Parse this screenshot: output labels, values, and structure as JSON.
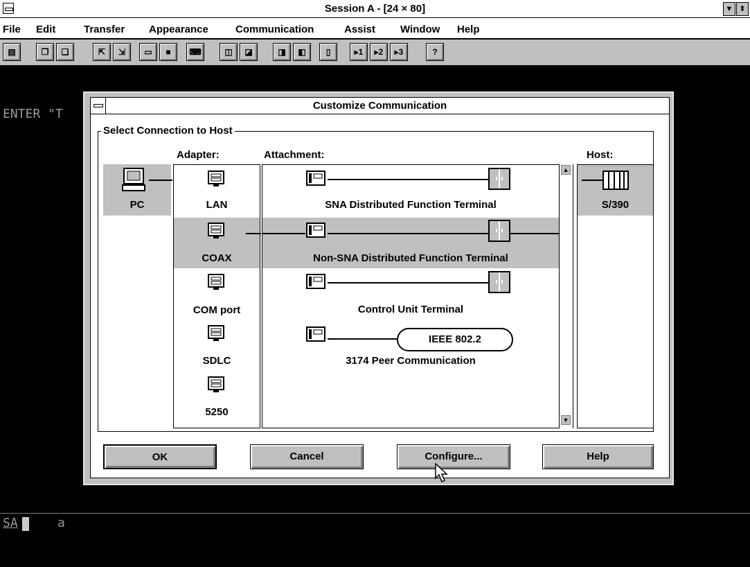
{
  "window": {
    "title": "Session A - [24 × 80]",
    "min_glyph": "▼",
    "max_glyph": "⬍"
  },
  "menu": [
    "File",
    "Edit",
    "Transfer",
    "Appearance",
    "Communication",
    "Assist",
    "Window",
    "Help"
  ],
  "toolbar": {
    "icons": [
      "print-icon",
      "copy-icon",
      "paste-icon",
      "send-file-icon",
      "receive-file-icon",
      "display-icon",
      "display-setup-icon",
      "keyboard-icon",
      "macro-icon",
      "macro-play-icon",
      "connect-icon",
      "disconnect-icon",
      "clipboard-icon",
      "session-1-icon",
      "session-2-icon",
      "session-3-icon",
      "help-icon"
    ],
    "session_labels": [
      "1",
      "2",
      "3"
    ],
    "help_glyph": "?"
  },
  "terminal": {
    "prompt_text": "ENTER \"T",
    "status_left": "SA",
    "status_char": "a"
  },
  "dialog": {
    "title": "Customize Communication",
    "group_label": "Select Connection to Host",
    "adapter_header": "Adapter:",
    "attachment_header": "Attachment:",
    "host_header": "Host:",
    "pc_label": "PC",
    "adapters": [
      "LAN",
      "COAX",
      "COM port",
      "SDLC",
      "5250"
    ],
    "selected_adapter": "COAX",
    "attachments": [
      "SNA Distributed Function Terminal",
      "Non-SNA Distributed Function Terminal",
      "Control Unit Terminal",
      "3174 Peer Communication"
    ],
    "selected_attachment": "Non-SNA Distributed Function Terminal",
    "ieee_label": "IEEE 802.2",
    "host": "S/390",
    "buttons": {
      "ok": "OK",
      "cancel": "Cancel",
      "configure": "Configure...",
      "help": "Help"
    }
  },
  "colors": {
    "title_bg": "#ffffff",
    "selection_bg": "#c0c0c0",
    "terminal_bg": "#000000",
    "terminal_text": "#9a9a9a"
  }
}
